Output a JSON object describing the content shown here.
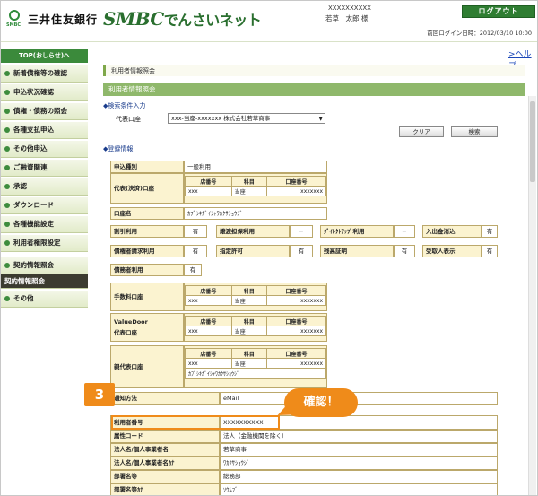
{
  "header": {
    "bank_name": "三井住友銀行",
    "bank_logo_sub": "SMBC",
    "service_name_latin": "SMBC",
    "service_name_jp": "でんさいネット",
    "user_id": "XXXXXXXXXX",
    "user_name": "若草　太郎 様",
    "logout_label": "ログアウト",
    "last_login": "前回ログイン日時：2012/03/10 10:00",
    "help_label": "ヘルプ"
  },
  "sidebar": {
    "top_label": "TOP(おしらせ)へ",
    "items": [
      {
        "label": "新着債権等の確認"
      },
      {
        "label": "申込状況確認"
      },
      {
        "label": "債権・債務の照会"
      },
      {
        "label": "各種支払申込"
      },
      {
        "label": "その他申込"
      },
      {
        "label": "ご融資関連"
      },
      {
        "label": "承認"
      },
      {
        "label": "ダウンロード"
      },
      {
        "label": "各種機能設定"
      },
      {
        "label": "利用者権限設定"
      },
      {
        "label": "契約情報照会"
      },
      {
        "label": "契約情報照会"
      },
      {
        "label": "その他"
      }
    ]
  },
  "main": {
    "breadcrumb": "利用者情報照会",
    "page_title": "利用者情報照会",
    "search_section": "◆検索条件入力",
    "rep_account_label": "代表口座",
    "rep_account_value": "xxx-当座-xxxxxxx 株式会社若草商事",
    "clear_label": "クリア",
    "search_label": "検索",
    "registration_section": "◆登録情報",
    "contract_type_label": "申込種別",
    "contract_type_value": "一般利用",
    "rep_settle_label": "代表(決済)口座",
    "col_branch": "店番号",
    "col_type": "科目",
    "col_account": "口座番号",
    "acct_branch": "xxx",
    "acct_type": "当座",
    "acct_number": "xxxxxxx",
    "account_name_label": "口座名",
    "account_name_value": "ｶﾌﾞｼｷｶﾞｲｼｬﾜｶｸｻｼｮｳｼﾞ",
    "flags": [
      {
        "label": "割引利用",
        "value": "有"
      },
      {
        "label": "譲渡担保利用",
        "value": "−"
      },
      {
        "label": "ﾀﾞｲﾚｸﾄｱｯﾌﾟ利用",
        "value": "−"
      },
      {
        "label": "入出金消込",
        "value": "有"
      },
      {
        "label": "債権者請求利用",
        "value": "有"
      },
      {
        "label": "指定許可",
        "value": "有"
      },
      {
        "label": "残高証明",
        "value": "有"
      },
      {
        "label": "受取人表示",
        "value": "有"
      }
    ],
    "debtor_use_label": "債務者利用",
    "debtor_use_value": "有",
    "fee_account_label": "手数料口座",
    "valuedoor_label_1": "ValueDoor",
    "valuedoor_label_2": "代表口座",
    "parent_account_label": "親代表口座",
    "parent_account_kana": "ｶﾌﾞｼｷｶﾞｲｼｬﾜｶｸｻｼｮｳｼﾞ",
    "notify_label": "通知方法",
    "notify_value": "eMail",
    "user_number_label": "利用者番号",
    "user_number_value": "XXXXXXXXXX",
    "attribute_label": "属性コード",
    "attribute_value": "法人（金融機関を除く）",
    "corp_name_label": "法人名/個人事業者名",
    "corp_name_value": "若草商事",
    "corp_kana_label": "法人名/個人事業者名ｶﾅ",
    "corp_kana_value": "ﾜｶｸｻｼｮｳｼﾞ",
    "dept_label": "部署名等",
    "dept_value": "総務部",
    "dept_kana_label": "部署名等ｶﾅ",
    "dept_kana_value": "ｿｳﾑﾌﾞ"
  },
  "callouts": {
    "step_number": "3",
    "confirm_text": "確認！"
  },
  "colors": {
    "accent_green": "#3b8a3b",
    "callout_orange": "#ef8b1a",
    "header_cell": "#fbf3d0"
  }
}
